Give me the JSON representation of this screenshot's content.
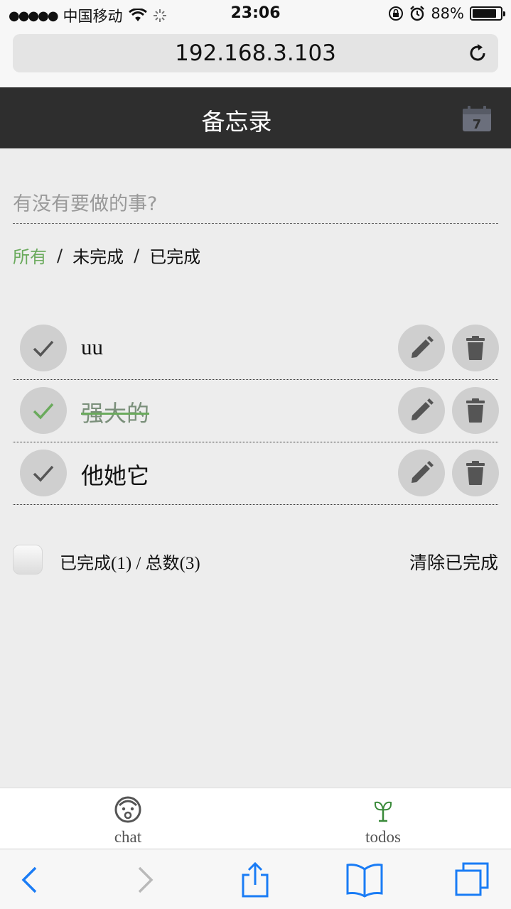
{
  "status_bar": {
    "signal": "●●●●●",
    "carrier": "中国移动",
    "time": "23:06",
    "battery": "88%",
    "battery_level": 0.88
  },
  "browser": {
    "url": "192.168.3.103"
  },
  "header": {
    "title": "备忘录",
    "calendar_day": "7"
  },
  "new_todo": {
    "placeholder": "有没有要做的事?"
  },
  "filters": {
    "all": "所有",
    "active": "未完成",
    "completed": "已完成",
    "separator": "/"
  },
  "todos": [
    {
      "text": "uu",
      "completed": false
    },
    {
      "text": "强大的",
      "completed": true
    },
    {
      "text": "他她它",
      "completed": false
    }
  ],
  "footer": {
    "done_label": "已完成",
    "done_count": "(1)",
    "slash": " / ",
    "total_label": "总数",
    "total_count": "(3)",
    "clear_label": "清除已完成"
  },
  "app_tabs": {
    "chat": "chat",
    "todos": "todos"
  },
  "colors": {
    "accent": "#6aaa5c",
    "header_bg": "#2e2e2e",
    "button_bg": "#cfcfcf",
    "icon": "#555555",
    "ios_blue": "#1a7cf5"
  }
}
